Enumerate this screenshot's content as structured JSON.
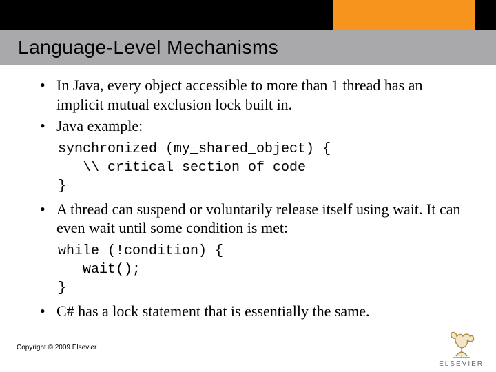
{
  "title": "Language-Level Mechanisms",
  "bullets": {
    "b1": "In Java, every object accessible to more than 1 thread has an implicit mutual exclusion lock built in.",
    "b2": "Java example:",
    "b3": "A thread can suspend or voluntarily release itself using wait.  It can even wait until some condition is met:",
    "b4": "C# has a lock statement that is essentially the same."
  },
  "code1": {
    "l1": "synchronized (my_shared_object) {",
    "l2": "   \\\\ critical section of code",
    "l3": "}"
  },
  "code2": {
    "l1": "while (!condition) {",
    "l2": "   wait();",
    "l3": "}"
  },
  "copyright": "Copyright © 2009 Elsevier",
  "logo_text": "ELSEVIER"
}
